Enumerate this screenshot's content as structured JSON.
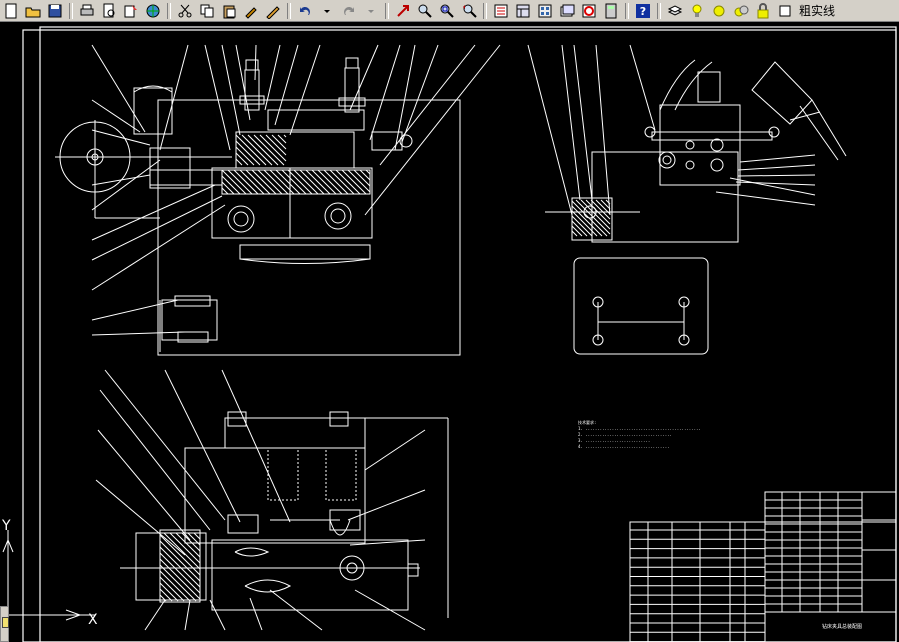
{
  "toolbar": {
    "buttons": [
      {
        "name": "new-icon"
      },
      {
        "name": "open-icon"
      },
      {
        "name": "save-icon"
      },
      {
        "sep": true
      },
      {
        "name": "print-icon"
      },
      {
        "name": "print-preview-icon"
      },
      {
        "name": "publish-icon"
      },
      {
        "name": "web-icon"
      },
      {
        "sep": true
      },
      {
        "name": "cut-icon"
      },
      {
        "name": "copy-icon"
      },
      {
        "name": "paste-icon"
      },
      {
        "name": "match-properties-icon"
      },
      {
        "name": "block-editor-icon"
      },
      {
        "sep": true
      },
      {
        "name": "undo-icon"
      },
      {
        "name": "undo-dropdown-icon"
      },
      {
        "name": "redo-icon"
      },
      {
        "name": "redo-dropdown-icon"
      },
      {
        "sep": true
      },
      {
        "name": "pan-icon"
      },
      {
        "name": "zoom-realtime-icon"
      },
      {
        "name": "zoom-window-icon"
      },
      {
        "name": "zoom-previous-icon"
      },
      {
        "sep": true
      },
      {
        "name": "properties-icon"
      },
      {
        "name": "design-center-icon"
      },
      {
        "name": "tool-palettes-icon"
      },
      {
        "name": "sheet-set-icon"
      },
      {
        "name": "markup-icon"
      },
      {
        "name": "calculator-icon"
      },
      {
        "sep": true
      },
      {
        "name": "help-icon"
      }
    ],
    "layer": {
      "icons": [
        "layers-icon",
        "bulb-icon",
        "sun-icon",
        "freeze-icon",
        "lock-icon",
        "color-swatch-icon"
      ],
      "current_layer": "粗实线"
    }
  },
  "colors": {
    "background": "#000000",
    "lines": "#ffffff",
    "toolbar": "#d4d0c8"
  },
  "ucs": {
    "x_label": "X",
    "y_label": "Y"
  },
  "tech_notes": [
    "技术要求:",
    "1. ................................................",
    "2. ....................................",
    "3. ...........................",
    "4. ..................................."
  ],
  "title_block": {
    "title": "钻床夹具总装配图"
  }
}
